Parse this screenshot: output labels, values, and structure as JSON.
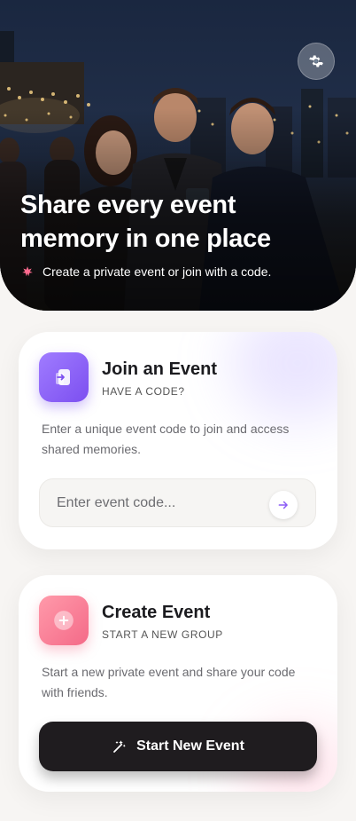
{
  "hero": {
    "title": "Share every event memory in one place",
    "subtitle": "Create a private event or join with a code.",
    "settings_icon": "gear-icon",
    "subtitle_icon": "sparkle-icon"
  },
  "join_card": {
    "title": "Join an Event",
    "kicker": "HAVE A CODE?",
    "description": "Enter a unique event code to join and access shared memories.",
    "input_placeholder": "Enter event code...",
    "input_value": "",
    "icon": "enter-icon",
    "submit_icon": "arrow-right-icon",
    "accent": "#8b5cf6"
  },
  "create_card": {
    "title": "Create Event",
    "kicker": "START A NEW GROUP",
    "description": "Start a new private event and share your code with friends.",
    "button_label": "Start New Event",
    "icon": "plus-icon",
    "button_icon": "magic-wand-icon",
    "accent": "#f26d8a"
  }
}
